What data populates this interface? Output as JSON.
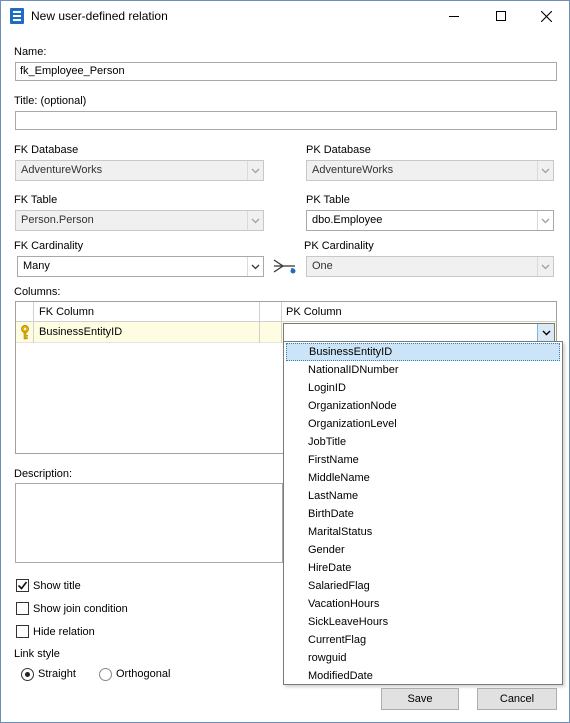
{
  "window": {
    "title": "New user-defined relation"
  },
  "name": {
    "label": "Name:",
    "value": "fk_Employee_Person"
  },
  "title": {
    "label": "Title: (optional)",
    "value": ""
  },
  "fk": {
    "database_label": "FK Database",
    "database_value": "AdventureWorks",
    "table_label": "FK Table",
    "table_value": "Person.Person",
    "cardinality_label": "FK Cardinality",
    "cardinality_value": "Many"
  },
  "pk": {
    "database_label": "PK Database",
    "database_value": "AdventureWorks",
    "table_label": "PK Table",
    "table_value": "dbo.Employee",
    "cardinality_label": "PK Cardinality",
    "cardinality_value": "One"
  },
  "columns": {
    "label": "Columns:",
    "headers": {
      "fk": "FK Column",
      "pk": "PK Column"
    },
    "row": {
      "fk_value": "BusinessEntityID",
      "pk_value": ""
    }
  },
  "pk_column_options": [
    "BusinessEntityID",
    "NationalIDNumber",
    "LoginID",
    "OrganizationNode",
    "OrganizationLevel",
    "JobTitle",
    "FirstName",
    "MiddleName",
    "LastName",
    "BirthDate",
    "MaritalStatus",
    "Gender",
    "HireDate",
    "SalariedFlag",
    "VacationHours",
    "SickLeaveHours",
    "CurrentFlag",
    "rowguid",
    "ModifiedDate"
  ],
  "description": {
    "label": "Description:",
    "value": ""
  },
  "options": {
    "show_title": "Show title",
    "show_title_checked": true,
    "show_join": "Show join condition",
    "show_join_checked": false,
    "hide_relation": "Hide relation",
    "hide_relation_checked": false
  },
  "link_style": {
    "label": "Link style",
    "straight": "Straight",
    "orthogonal": "Orthogonal",
    "selected": "Straight"
  },
  "buttons": {
    "save": "Save",
    "cancel": "Cancel"
  },
  "colors": {
    "accent": "#1f6cc4",
    "row_highlight": "#fffde1",
    "selection": "#cce4f7"
  }
}
